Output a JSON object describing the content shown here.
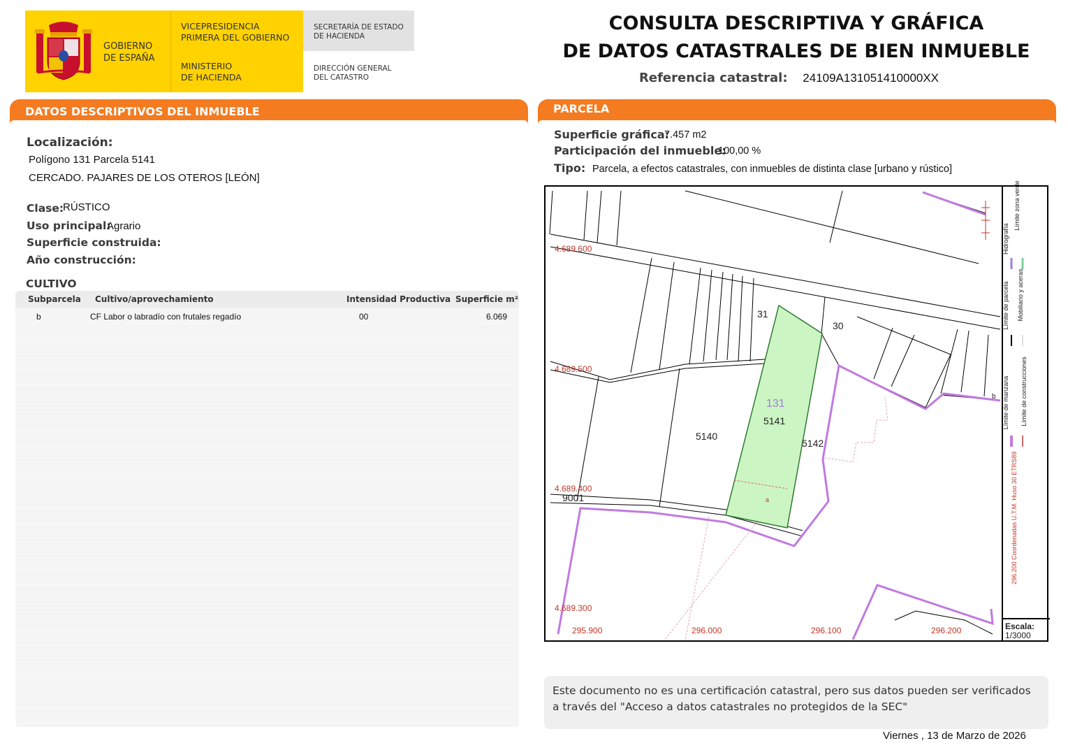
{
  "header": {
    "gov_name": "GOBIERNO\nDE ESPAÑA",
    "vice": "VICEPRESIDENCIA\nPRIMERA DEL GOBIERNO",
    "ministry": "MINISTERIO\nDE HACIENDA",
    "secretary": "SECRETARÍA DE ESTADO\nDE HACIENDA",
    "direction": "DIRECCIÓN GENERAL\nDEL CATASTRO",
    "colors": {
      "yellow": "#ffd200",
      "grey": "#e2e2e2",
      "crest_red": "#c8102e"
    }
  },
  "title": {
    "line1": "CONSULTA DESCRIPTIVA Y GRÁFICA",
    "line2": "DE DATOS CATASTRALES DE BIEN INMUEBLE",
    "ref_label": "Referencia catastral:",
    "ref_value": "24109A131051410000XX"
  },
  "left": {
    "section_title": "DATOS DESCRIPTIVOS DEL INMUEBLE",
    "loc_label": "Localización:",
    "loc_line1": "Polígono 131 Parcela 5141",
    "loc_line2": "CERCADO. PAJARES DE LOS OTEROS [LEÓN]",
    "clase_label": "Clase:",
    "clase_value": "RÚSTICO",
    "uso_label": "Uso principal:",
    "uso_value": "Agrario",
    "sup_label": "Superficie construida:",
    "anio_label": "Año construcción:",
    "cultivo_title": "CULTIVO",
    "cultivo_headers": [
      "Subparcela",
      "Cultivo/aprovechamiento",
      "Intensidad Productiva",
      "Superficie m²"
    ],
    "cultivo_rows": [
      {
        "subparcela": "b",
        "cultivo": "CF Labor o labradío con frutales regadío",
        "intensidad": "00",
        "superficie": "6.069"
      }
    ]
  },
  "right": {
    "section_title": "PARCELA",
    "sup_label": "Superficie gráfica:",
    "sup_value": "7.457 m2",
    "part_label": "Participación del inmueble:",
    "part_value": "100,00 %",
    "tipo_label": "Tipo:",
    "tipo_value": "Parcela, a efectos catastrales, con inmuebles de distinta clase [urbano y rústico]"
  },
  "map": {
    "y_coords": [
      "4.689.600",
      "4.689.500",
      "4.689.400",
      "4.689.300"
    ],
    "x_coords": [
      "295.900",
      "296.000",
      "296.100",
      "296.200"
    ],
    "parcels": {
      "p31": "31",
      "p30": "30",
      "poly": "131",
      "p5141": "5141",
      "p5140": "5140",
      "p5142": "5142",
      "p9001": "9001",
      "sub_a": "a",
      "sub_b": "b"
    },
    "legend": {
      "hidro": "Hidrografía",
      "zona_verde": "Límite zona verde",
      "parcela": "Límite de parcela",
      "mobiliario": "Mobiliario y aceras",
      "manzana": "Límite de manzana",
      "construcciones": "Límite de construcciones",
      "coords": "Coordenadas U.T.M. Huso 30 ETRS89",
      "coord_origin": "296.200"
    },
    "escala_label": "Escala:",
    "escala_value": "1/3000",
    "colors": {
      "parcel_fill": "#ccf5c4",
      "parcel_stroke": "#2f7a2f",
      "purple": "#c07ae0",
      "coord_red": "#c0392b",
      "poly_label": "#9b7fd6"
    }
  },
  "footer": {
    "notice": "Este documento no es una certificación catastral, pero sus datos pueden ser verificados a través del \"Acceso a datos catastrales no protegidos de la SEC\"",
    "date": "Viernes , 13 de Marzo de 2026"
  }
}
